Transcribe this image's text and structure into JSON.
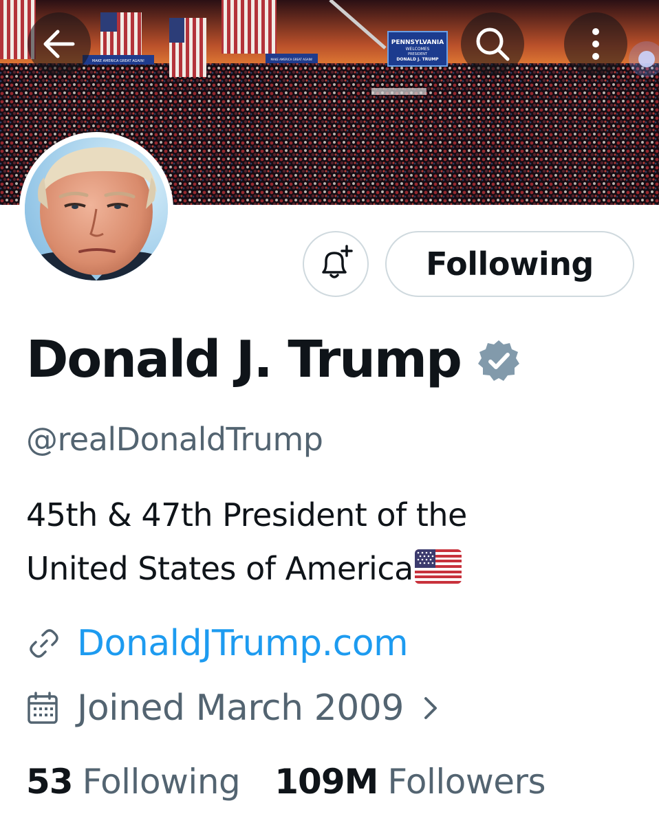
{
  "header": {
    "back_icon": "arrow-left-icon",
    "search_icon": "search-icon",
    "more_icon": "more-vertical-icon"
  },
  "banner": {
    "sign_text": [
      "PENNSYLVANIA",
      "WELCOMES",
      "PRESIDENT",
      "DONALD J. TRUMP"
    ],
    "banner_text_left": "MAKE AMERICA GREAT AGAIN!",
    "banner_text_center": "MAKE AMERICA GREAT AGAIN!"
  },
  "actions": {
    "notify_icon": "bell-plus-icon",
    "follow_label": "Following"
  },
  "profile": {
    "display_name": "Donald J. Trump",
    "verified_icon": "verified-badge-icon",
    "handle": "@realDonaldTrump",
    "bio_line1": "45th & 47th President of the",
    "bio_line2": "United States of America",
    "bio_emoji": "us-flag-emoji",
    "website": "DonaldJTrump.com",
    "joined": "Joined March 2009"
  },
  "stats": {
    "following_count": "53",
    "following_label": "Following",
    "followers_count": "109M",
    "followers_label": "Followers"
  },
  "colors": {
    "text_primary": "#0f1419",
    "text_secondary": "#536471",
    "link": "#1d9bf0",
    "border": "#cfd9de",
    "verified": "#829aab"
  }
}
